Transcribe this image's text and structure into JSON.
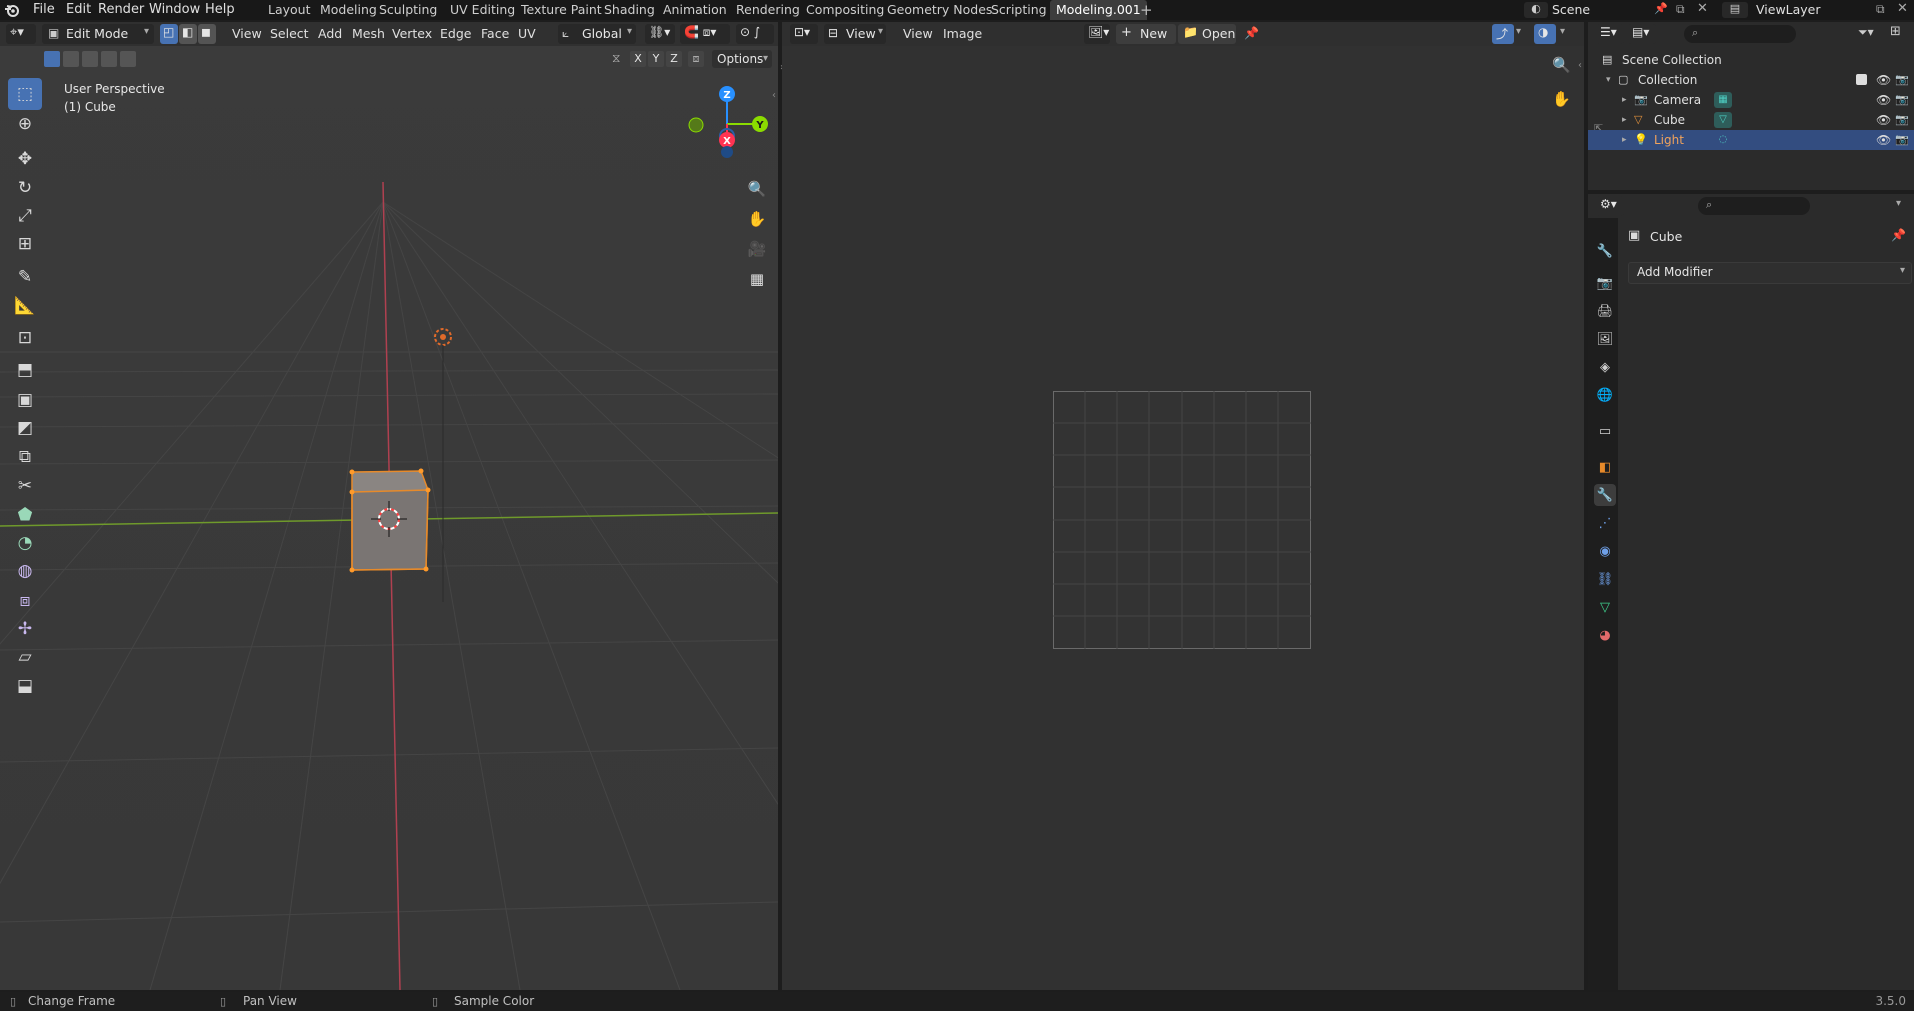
{
  "app": {
    "logo_icon": "blender-logo-icon",
    "version": "3.5.0"
  },
  "menu": [
    "File",
    "Edit",
    "Render",
    "Window",
    "Help"
  ],
  "workspaces": [
    {
      "label": "Layout",
      "active": false
    },
    {
      "label": "Modeling",
      "active": false
    },
    {
      "label": "Sculpting",
      "active": false
    },
    {
      "label": "UV Editing",
      "active": false
    },
    {
      "label": "Texture Paint",
      "active": false
    },
    {
      "label": "Shading",
      "active": false
    },
    {
      "label": "Animation",
      "active": false
    },
    {
      "label": "Rendering",
      "active": false
    },
    {
      "label": "Compositing",
      "active": false
    },
    {
      "label": "Geometry Nodes",
      "active": false
    },
    {
      "label": "Scripting",
      "active": false
    },
    {
      "label": "Modeling.001",
      "active": true
    }
  ],
  "scene": {
    "name": "Scene",
    "view_layer": "ViewLayer"
  },
  "viewport": {
    "mode": "Edit Mode",
    "menus": [
      "View",
      "Select",
      "Add",
      "Mesh",
      "Vertex",
      "Edge",
      "Face",
      "UV"
    ],
    "orientation": "Global",
    "axes": [
      "X",
      "Y",
      "Z"
    ],
    "options_label": "Options",
    "overlay_title": "User Perspective",
    "overlay_object": "(1) Cube",
    "gizmo": {
      "x": "X",
      "y": "Y",
      "z": "Z"
    },
    "tools": [
      {
        "icon": "select-box-icon",
        "active": true
      },
      {
        "icon": "cursor-icon",
        "active": false
      },
      {
        "icon": "move-icon",
        "active": false
      },
      {
        "icon": "rotate-icon",
        "active": false
      },
      {
        "icon": "scale-icon",
        "active": false
      },
      {
        "icon": "transform-icon",
        "active": false
      },
      {
        "icon": "annotate-icon",
        "active": false
      },
      {
        "icon": "measure-icon",
        "active": false
      },
      {
        "icon": "add-cube-icon",
        "active": false
      },
      {
        "icon": "extrude-region-icon",
        "active": false
      },
      {
        "icon": "inset-faces-icon",
        "active": false
      },
      {
        "icon": "bevel-icon",
        "active": false
      },
      {
        "icon": "loop-cut-icon",
        "active": false
      },
      {
        "icon": "knife-icon",
        "active": false
      },
      {
        "icon": "poly-build-icon",
        "active": false
      },
      {
        "icon": "spin-icon",
        "active": false
      },
      {
        "icon": "smooth-icon",
        "active": false
      },
      {
        "icon": "edge-slide-icon",
        "active": false
      },
      {
        "icon": "shrink-fatten-icon",
        "active": false
      },
      {
        "icon": "shear-icon",
        "active": false
      },
      {
        "icon": "rip-region-icon",
        "active": false
      }
    ],
    "nav_icons": [
      "zoom-icon",
      "pan-hand-icon",
      "camera-view-icon",
      "perspective-grid-icon"
    ]
  },
  "image_editor": {
    "menus": [
      "View",
      "Image"
    ],
    "view_label": "View",
    "new_label": "New",
    "open_label": "Open"
  },
  "outliner": {
    "search_placeholder": "",
    "rows": [
      {
        "label": "Scene Collection",
        "icon": "scene-collection-icon",
        "selected": false,
        "color": "#e0e0e0"
      },
      {
        "label": "Collection",
        "icon": "collection-icon",
        "selected": false,
        "color": "#e0e0e0"
      },
      {
        "label": "Camera",
        "icon": "camera-object-icon",
        "selected": false,
        "color": "#e0e0e0"
      },
      {
        "label": "Cube",
        "icon": "mesh-object-icon",
        "selected": false,
        "color": "#e0e0e0"
      },
      {
        "label": "Light",
        "icon": "light-object-icon",
        "selected": true,
        "color": "#f0a35c"
      }
    ]
  },
  "properties": {
    "object_name": "Cube",
    "add_modifier_label": "Add Modifier",
    "tabs": [
      {
        "icon": "tool-icon",
        "active": false
      },
      {
        "icon": "render-icon",
        "active": false
      },
      {
        "icon": "output-icon",
        "active": false
      },
      {
        "icon": "view-layer-icon",
        "active": false
      },
      {
        "icon": "scene-icon",
        "active": false
      },
      {
        "icon": "world-icon",
        "active": false
      },
      {
        "icon": "collection-props-icon",
        "active": false
      },
      {
        "icon": "object-icon",
        "active": false
      },
      {
        "icon": "modifier-wrench-icon",
        "active": true
      },
      {
        "icon": "particles-icon",
        "active": false
      },
      {
        "icon": "physics-icon",
        "active": false
      },
      {
        "icon": "constraints-icon",
        "active": false
      },
      {
        "icon": "data-icon",
        "active": false
      },
      {
        "icon": "material-icon",
        "active": false
      }
    ]
  },
  "status": {
    "left": "Change Frame",
    "middle": "Pan View",
    "right": "Sample Color"
  },
  "colors": {
    "accent": "#4772b3",
    "selected_orange": "#f0a35c",
    "x_axis": "#ff3352",
    "y_axis": "#8bdc00",
    "z_axis": "#2890ff"
  }
}
